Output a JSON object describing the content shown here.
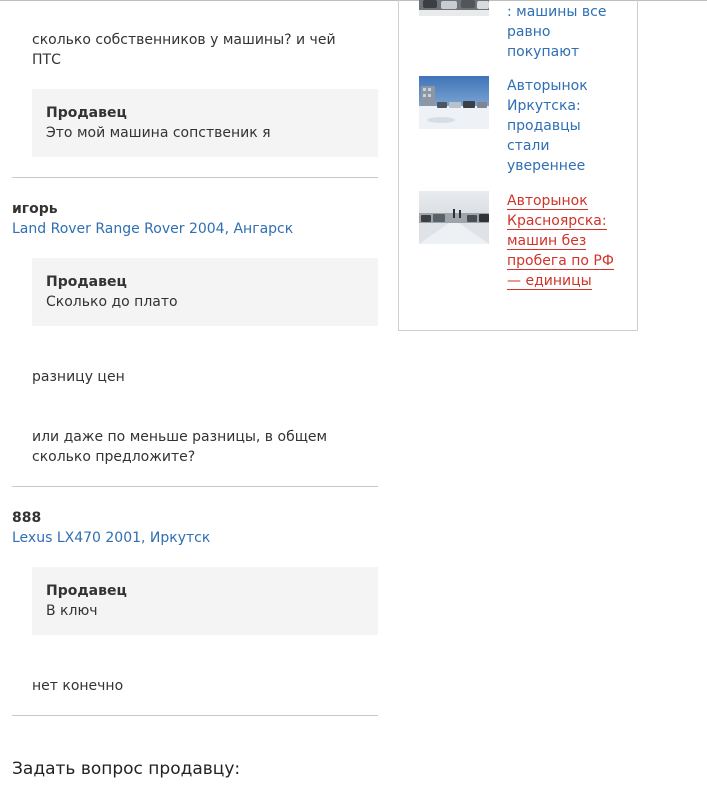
{
  "qa": {
    "thread1": {
      "question": "сколько собственников у машины? и чей ПТС",
      "answer_label": "Продавец",
      "answer": "Это мой машина сопственик я"
    },
    "thread2": {
      "author": "игорь",
      "car_link": "Land Rover Range Rover 2004, Ангарск",
      "answer_label": "Продавец",
      "answer": "Сколько до плато",
      "followup1": "разницу цен",
      "followup2": "или даже по меньше разницы, в общем сколько предложите?"
    },
    "thread3": {
      "author": "888",
      "car_link": "Lexus LX470 2001, Иркутск",
      "answer_label": "Продавец",
      "answer": "В ключ",
      "followup1": "нет конечно"
    },
    "ask_heading": "Задать вопрос продавцу:"
  },
  "news": {
    "items": [
      {
        "title": ": машины все равно покупают",
        "color": "#2f6fb3"
      },
      {
        "title": "Авторынок Иркутска: продавцы стали увереннее",
        "color": "#2f6fb3"
      },
      {
        "title": "Авторынок Красноярска: машин без пробега по РФ — единицы",
        "color": "#d0332a"
      }
    ]
  },
  "colors": {
    "link": "#2f6fb3",
    "link_active": "#d0332a",
    "answer_bg": "#f4f4f4",
    "divider": "#c8c8c8"
  }
}
